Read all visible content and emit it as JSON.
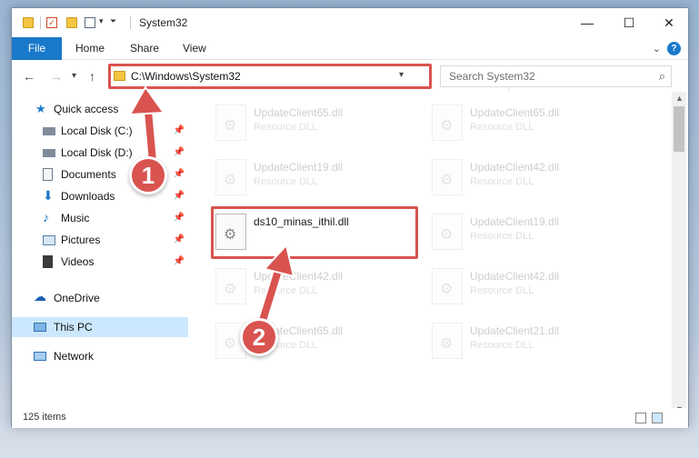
{
  "window": {
    "title": "System32",
    "controls": {
      "minimize": "—",
      "maximize": "☐",
      "close": "✕"
    }
  },
  "ribbon": {
    "tabs": [
      "File",
      "Home",
      "Share",
      "View"
    ],
    "help": "?"
  },
  "address": {
    "path": "C:\\Windows\\System32",
    "refresh": "↻"
  },
  "search": {
    "placeholder": "Search System32"
  },
  "nav": {
    "items": [
      {
        "label": "Quick access",
        "icon": "star-icon",
        "pinned": false
      },
      {
        "label": "Local Disk (C:)",
        "icon": "drive-icon",
        "pinned": true
      },
      {
        "label": "Local Disk (D:)",
        "icon": "drive-icon",
        "pinned": true
      },
      {
        "label": "Documents",
        "icon": "documents-icon",
        "pinned": true
      },
      {
        "label": "Downloads",
        "icon": "download-arrow-icon",
        "pinned": true
      },
      {
        "label": "Music",
        "icon": "music-note-icon",
        "pinned": true
      },
      {
        "label": "Pictures",
        "icon": "pictures-icon",
        "pinned": true
      },
      {
        "label": "Videos",
        "icon": "film-icon",
        "pinned": true
      },
      {
        "label": "OneDrive",
        "icon": "cloud-icon",
        "pinned": false
      },
      {
        "label": "This PC",
        "icon": "monitor-icon",
        "pinned": false,
        "selected": true
      },
      {
        "label": "Network",
        "icon": "network-icon",
        "pinned": false
      }
    ]
  },
  "files": [
    {
      "name": "UpdateClient65.dll",
      "type": "Resource DLL"
    },
    {
      "name": "UpdateClient65.dll",
      "type": "Resource DLL"
    },
    {
      "name": "UpdateClient19.dll",
      "type": "Resource DLL"
    },
    {
      "name": "UpdateClient42.dll",
      "type": "Resource DLL"
    },
    {
      "name": "ds10_minas_ithil.dll",
      "type": ""
    },
    {
      "name": "UpdateClient19.dll",
      "type": "Resource DLL"
    },
    {
      "name": "UpdateClient42.dll",
      "type": "Resource DLL"
    },
    {
      "name": "UpdateClient42.dll",
      "type": "Resource DLL"
    },
    {
      "name": "UpdateClient65.dll",
      "type": "Resource DLL"
    },
    {
      "name": "UpdateClient21.dll",
      "type": "Resource DLL"
    }
  ],
  "status": {
    "item_count": "125 items"
  },
  "annotations": {
    "step1": "1",
    "step2": "2"
  },
  "colors": {
    "accent": "#1979ca",
    "highlight": "#d9534f",
    "selected_nav": "#cce8ff"
  }
}
